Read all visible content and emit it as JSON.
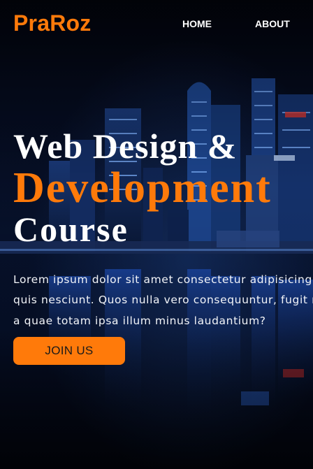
{
  "brand": {
    "logo": "PraRoz",
    "accent_color": "#ff7a0a"
  },
  "nav": {
    "links": [
      {
        "label": "HOME"
      },
      {
        "label": "ABOUT"
      }
    ]
  },
  "hero": {
    "headline_line1": "Web Design &",
    "headline_line2": "Development",
    "headline_line3": "Course",
    "paragraph_lines": [
      "Lorem ipsum dolor sit amet consectetur adipisicing elit.",
      "quis nesciunt. Quos nulla vero consequuntur, fugit nemo",
      "a quae totam ipsa illum minus laudantium?"
    ],
    "cta_label": "JOIN US",
    "background": "night-city-skyline-image"
  }
}
